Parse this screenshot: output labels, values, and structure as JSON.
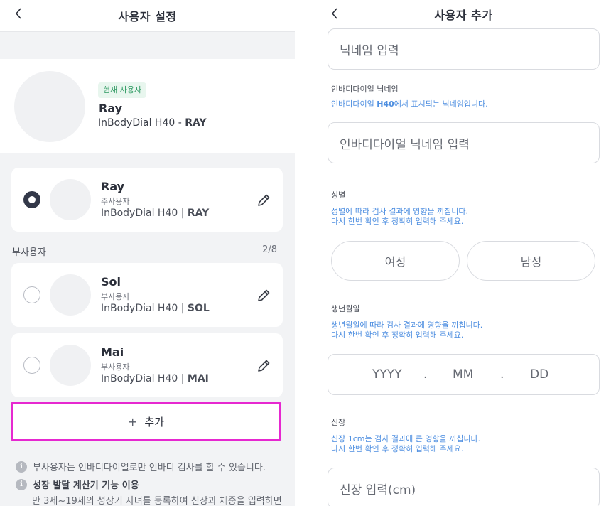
{
  "left_screen": {
    "nav_title": "사용자 설정",
    "current_user": {
      "badge": "현재 사용자",
      "name": "Ray",
      "device_prefix": "InBodyDial H40 - ",
      "device_id": "RAY"
    },
    "main_user": {
      "name": "Ray",
      "role": "주사용자",
      "device_prefix": "InBodyDial H40 | ",
      "device_id": "RAY",
      "selected": true
    },
    "sub_users_section": {
      "title": "부사용자",
      "count": "2/8"
    },
    "sub_users": [
      {
        "name": "Sol",
        "role": "부사용자",
        "device_prefix": "InBodyDial H40 | ",
        "device_id": "SOL",
        "selected": false
      },
      {
        "name": "Mai",
        "role": "부사용자",
        "device_prefix": "InBodyDial H40 | ",
        "device_id": "MAI",
        "selected": false
      }
    ],
    "add_button": {
      "plus": "+",
      "label": "추가"
    },
    "info": [
      {
        "text": "부사용자는 인바디다이얼로만 인바디 검사를 할 수 있습니다."
      },
      {
        "text": "성장 발달 계산기 기능 이용",
        "sub": "만 3세~19세의 성장기 자녀를 등록하여 신장과 체중을 입력하면"
      }
    ]
  },
  "right_screen": {
    "nav_title": "사용자 추가",
    "nickname_field": {
      "placeholder": "닉네임 입력"
    },
    "dial_nickname": {
      "label": "인바디다이얼 닉네임",
      "hint_pre": "인바디다이얼 ",
      "hint_bold": "H40",
      "hint_post": "에서 표시되는 닉네임입니다.",
      "placeholder": "인바디다이얼 닉네임 입력"
    },
    "gender": {
      "label": "성별",
      "hint_line1": "성별에 따라 검사 결과에 영향을 끼칩니다.",
      "hint_line2": "다시 한번 확인 후 정확히 입력해 주세요.",
      "options": [
        "여성",
        "남성"
      ]
    },
    "birth": {
      "label": "생년월일",
      "hint_line1": "생년월일에 따라 검사 결과에 영향을 끼칩니다.",
      "hint_line2": "다시 한번 확인 후 정확히 입력해 주세요.",
      "year": "YYYY",
      "sep": ".",
      "month": "MM",
      "day": "DD"
    },
    "height": {
      "label": "신장",
      "hint_line1": "신장 1cm는 검사 결과에 큰 영향을 끼칩니다.",
      "hint_line2": "다시 한번 확인 후 정확히 입력해 주세요.",
      "placeholder": "신장 입력(cm)"
    }
  },
  "icons": {
    "back": "chevron-left-icon",
    "edit": "pencil-icon",
    "info": "info-icon"
  },
  "colors": {
    "highlight_border": "#e628d0",
    "badge_bg": "#e8f6ee",
    "badge_text": "#2f9a62",
    "hint_blue": "#4d8ee0",
    "radio_selected": "#333849"
  }
}
